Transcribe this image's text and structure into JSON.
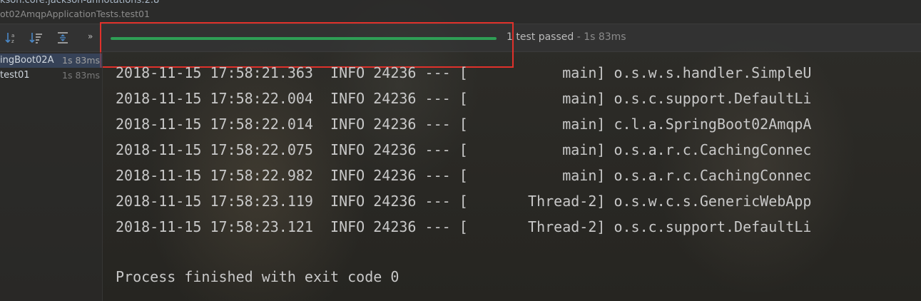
{
  "header": {
    "path_line": "kson.core:jackson-annotations:2.8",
    "test_class_path": "ot02AmqpApplicationTests.test01"
  },
  "toolbar": {
    "icons": [
      "sort-alpha-icon",
      "sort-duration-icon",
      "collapse-icon"
    ],
    "more_label": "»"
  },
  "test_status": {
    "summary": "1 test passed",
    "separator": " - ",
    "duration": "1s 83ms",
    "progress": 1.0,
    "progress_color": "#2e9e55"
  },
  "tree": {
    "items": [
      {
        "label": "ingBoot02A",
        "time": "1s 83ms",
        "selected": true
      },
      {
        "label": "test01",
        "time": "1s 83ms",
        "selected": false
      }
    ]
  },
  "console": {
    "lines": [
      {
        "timestamp": "2018-11-15 17:58:21.363",
        "level": "INFO",
        "pid": "24236",
        "sep": "---",
        "thread": "main",
        "logger": "o.s.w.s.handler.SimpleU"
      },
      {
        "timestamp": "2018-11-15 17:58:22.004",
        "level": "INFO",
        "pid": "24236",
        "sep": "---",
        "thread": "main",
        "logger": "o.s.c.support.DefaultLi"
      },
      {
        "timestamp": "2018-11-15 17:58:22.014",
        "level": "INFO",
        "pid": "24236",
        "sep": "---",
        "thread": "main",
        "logger": "c.l.a.SpringBoot02AmqpA"
      },
      {
        "timestamp": "2018-11-15 17:58:22.075",
        "level": "INFO",
        "pid": "24236",
        "sep": "---",
        "thread": "main",
        "logger": "o.s.a.r.c.CachingConnec"
      },
      {
        "timestamp": "2018-11-15 17:58:22.982",
        "level": "INFO",
        "pid": "24236",
        "sep": "---",
        "thread": "main",
        "logger": "o.s.a.r.c.CachingConnec"
      },
      {
        "timestamp": "2018-11-15 17:58:23.119",
        "level": "INFO",
        "pid": "24236",
        "sep": "---",
        "thread": "Thread-2",
        "logger": "o.s.w.c.s.GenericWebApp"
      },
      {
        "timestamp": "2018-11-15 17:58:23.121",
        "level": "INFO",
        "pid": "24236",
        "sep": "---",
        "thread": "Thread-2",
        "logger": "o.s.c.support.DefaultLi"
      }
    ],
    "exit_message": "Process finished with exit code 0"
  },
  "colors": {
    "highlight_border": "#e0312b",
    "selection": "#4b6eaf"
  }
}
